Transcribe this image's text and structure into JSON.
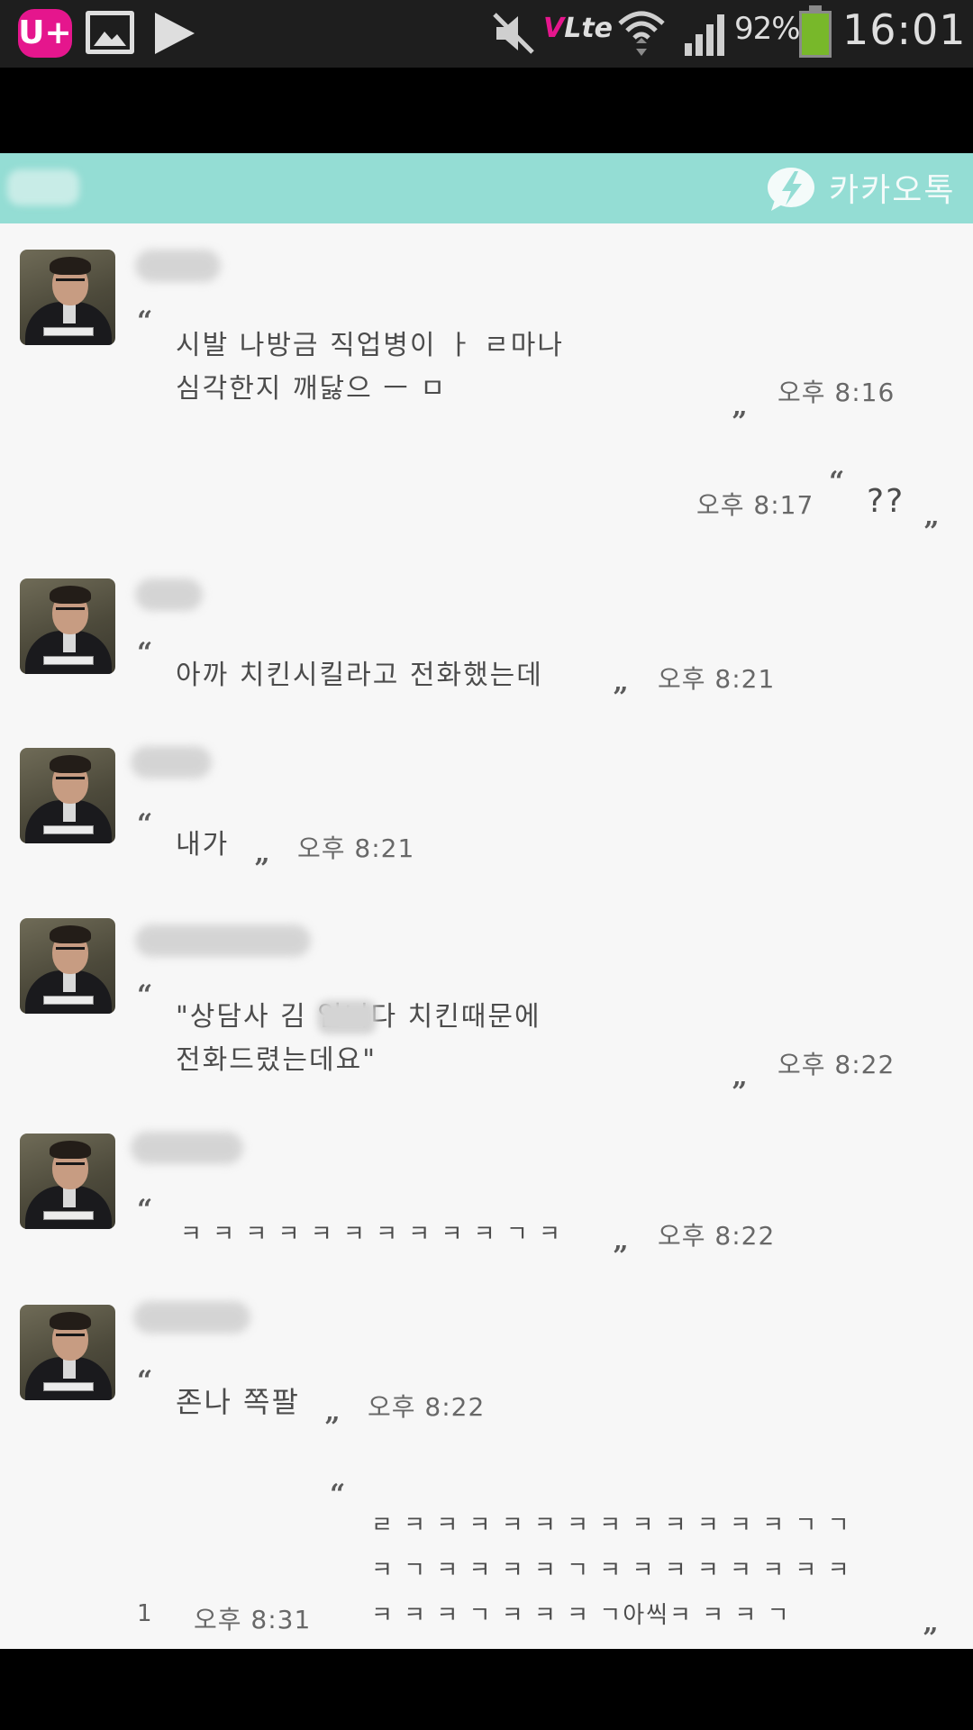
{
  "status_bar": {
    "carrier_icon": "U+",
    "volte": {
      "v": "V",
      "text": "Lte"
    },
    "battery_text": "92%",
    "battery_level": 0.92,
    "time": "16:01",
    "icons": [
      "uplus-icon",
      "gallery-icon",
      "play-icon",
      "mute-icon",
      "volte-icon",
      "wifi-icon",
      "signal-icon",
      "battery-icon"
    ]
  },
  "header": {
    "app_title": "카카오톡",
    "logo_icon": "kakaotalk-logo-icon",
    "color": "#94ddd4"
  },
  "messages": [
    {
      "lines": [
        "시발 나방금 직업병이 ㅏ ㄹ마나",
        "심각한지 깨닳으 ㅡ ㅁ"
      ],
      "time": "오후 8:16"
    },
    {
      "text": "??",
      "time": "오후 8:17"
    },
    {
      "lines": [
        "아까 치킨시킬라고 전화했는데"
      ],
      "time": "오후 8:21"
    },
    {
      "lines": [
        "내가"
      ],
      "time": "오후 8:21"
    },
    {
      "lines": [
        "\"상담사 김     입니다 치킨때문에",
        "전화드렸는데요\""
      ],
      "time": "오후 8:22"
    },
    {
      "lines": [
        "ㅋ ㅋ ㅋ ㅋ ㅋ ㅋ ㅋ ㅋ ㅋ ㅋ ㄱ ㅋ"
      ],
      "time": "오후 8:22"
    },
    {
      "lines": [
        "존나 쪽팔"
      ],
      "time": "오후 8:22"
    },
    {
      "lines": [
        "ㄹ ㅋ ㅋ ㅋ ㅋ ㅋ ㅋ ㅋ ㅋ ㅋ ㅋ ㅋ ㅋ ㄱ ㄱ",
        "ㅋ ㄱ ㅋ ㅋ ㅋ ㅋ ㄱ ㅋ ㅋ ㅋ ㅋ ㅋ ㅋ ㅋ ㅋ",
        "ㅋ ㅋ ㅋ ㄱ ㅋ ㅋ ㅋ ㄱ아씩ㅋ ㅋ ㅋ ㄱ"
      ],
      "unread": "1",
      "time": "오후 8:31"
    }
  ]
}
